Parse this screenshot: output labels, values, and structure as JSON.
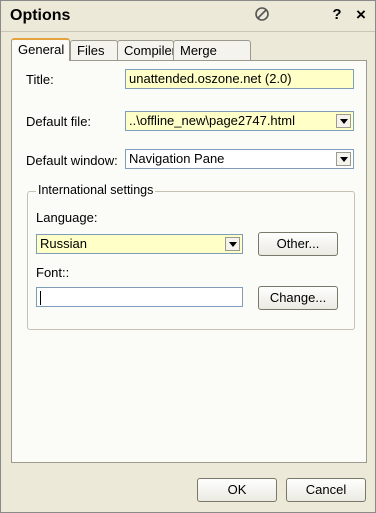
{
  "window": {
    "title": "Options"
  },
  "titlebar": {
    "help_label": "?",
    "close_label": "×",
    "pin_icon": "no-entry-icon"
  },
  "tabs": [
    {
      "label": "General",
      "active": true
    },
    {
      "label": "Files",
      "active": false
    },
    {
      "label": "Compiler",
      "active": false
    },
    {
      "label": "Merge Files",
      "active": false
    }
  ],
  "general": {
    "title_label": "Title:",
    "title_value": "unattended.oszone.net (2.0)",
    "default_file_label": "Default file:",
    "default_file_value": "..\\offline_new\\page2747.html",
    "default_window_label": "Default window:",
    "default_window_value": "Navigation Pane",
    "intl_group_label": "International settings",
    "language_label": "Language:",
    "language_value": "Russian",
    "other_button": "Other...",
    "font_label": "Font::",
    "font_value": "",
    "change_button": "Change..."
  },
  "footer": {
    "ok_label": "OK",
    "cancel_label": "Cancel"
  },
  "colors": {
    "highlight_field": "#ffffc8",
    "tab_accent": "#e3a43e",
    "dialog_bg": "#ece9d8"
  }
}
